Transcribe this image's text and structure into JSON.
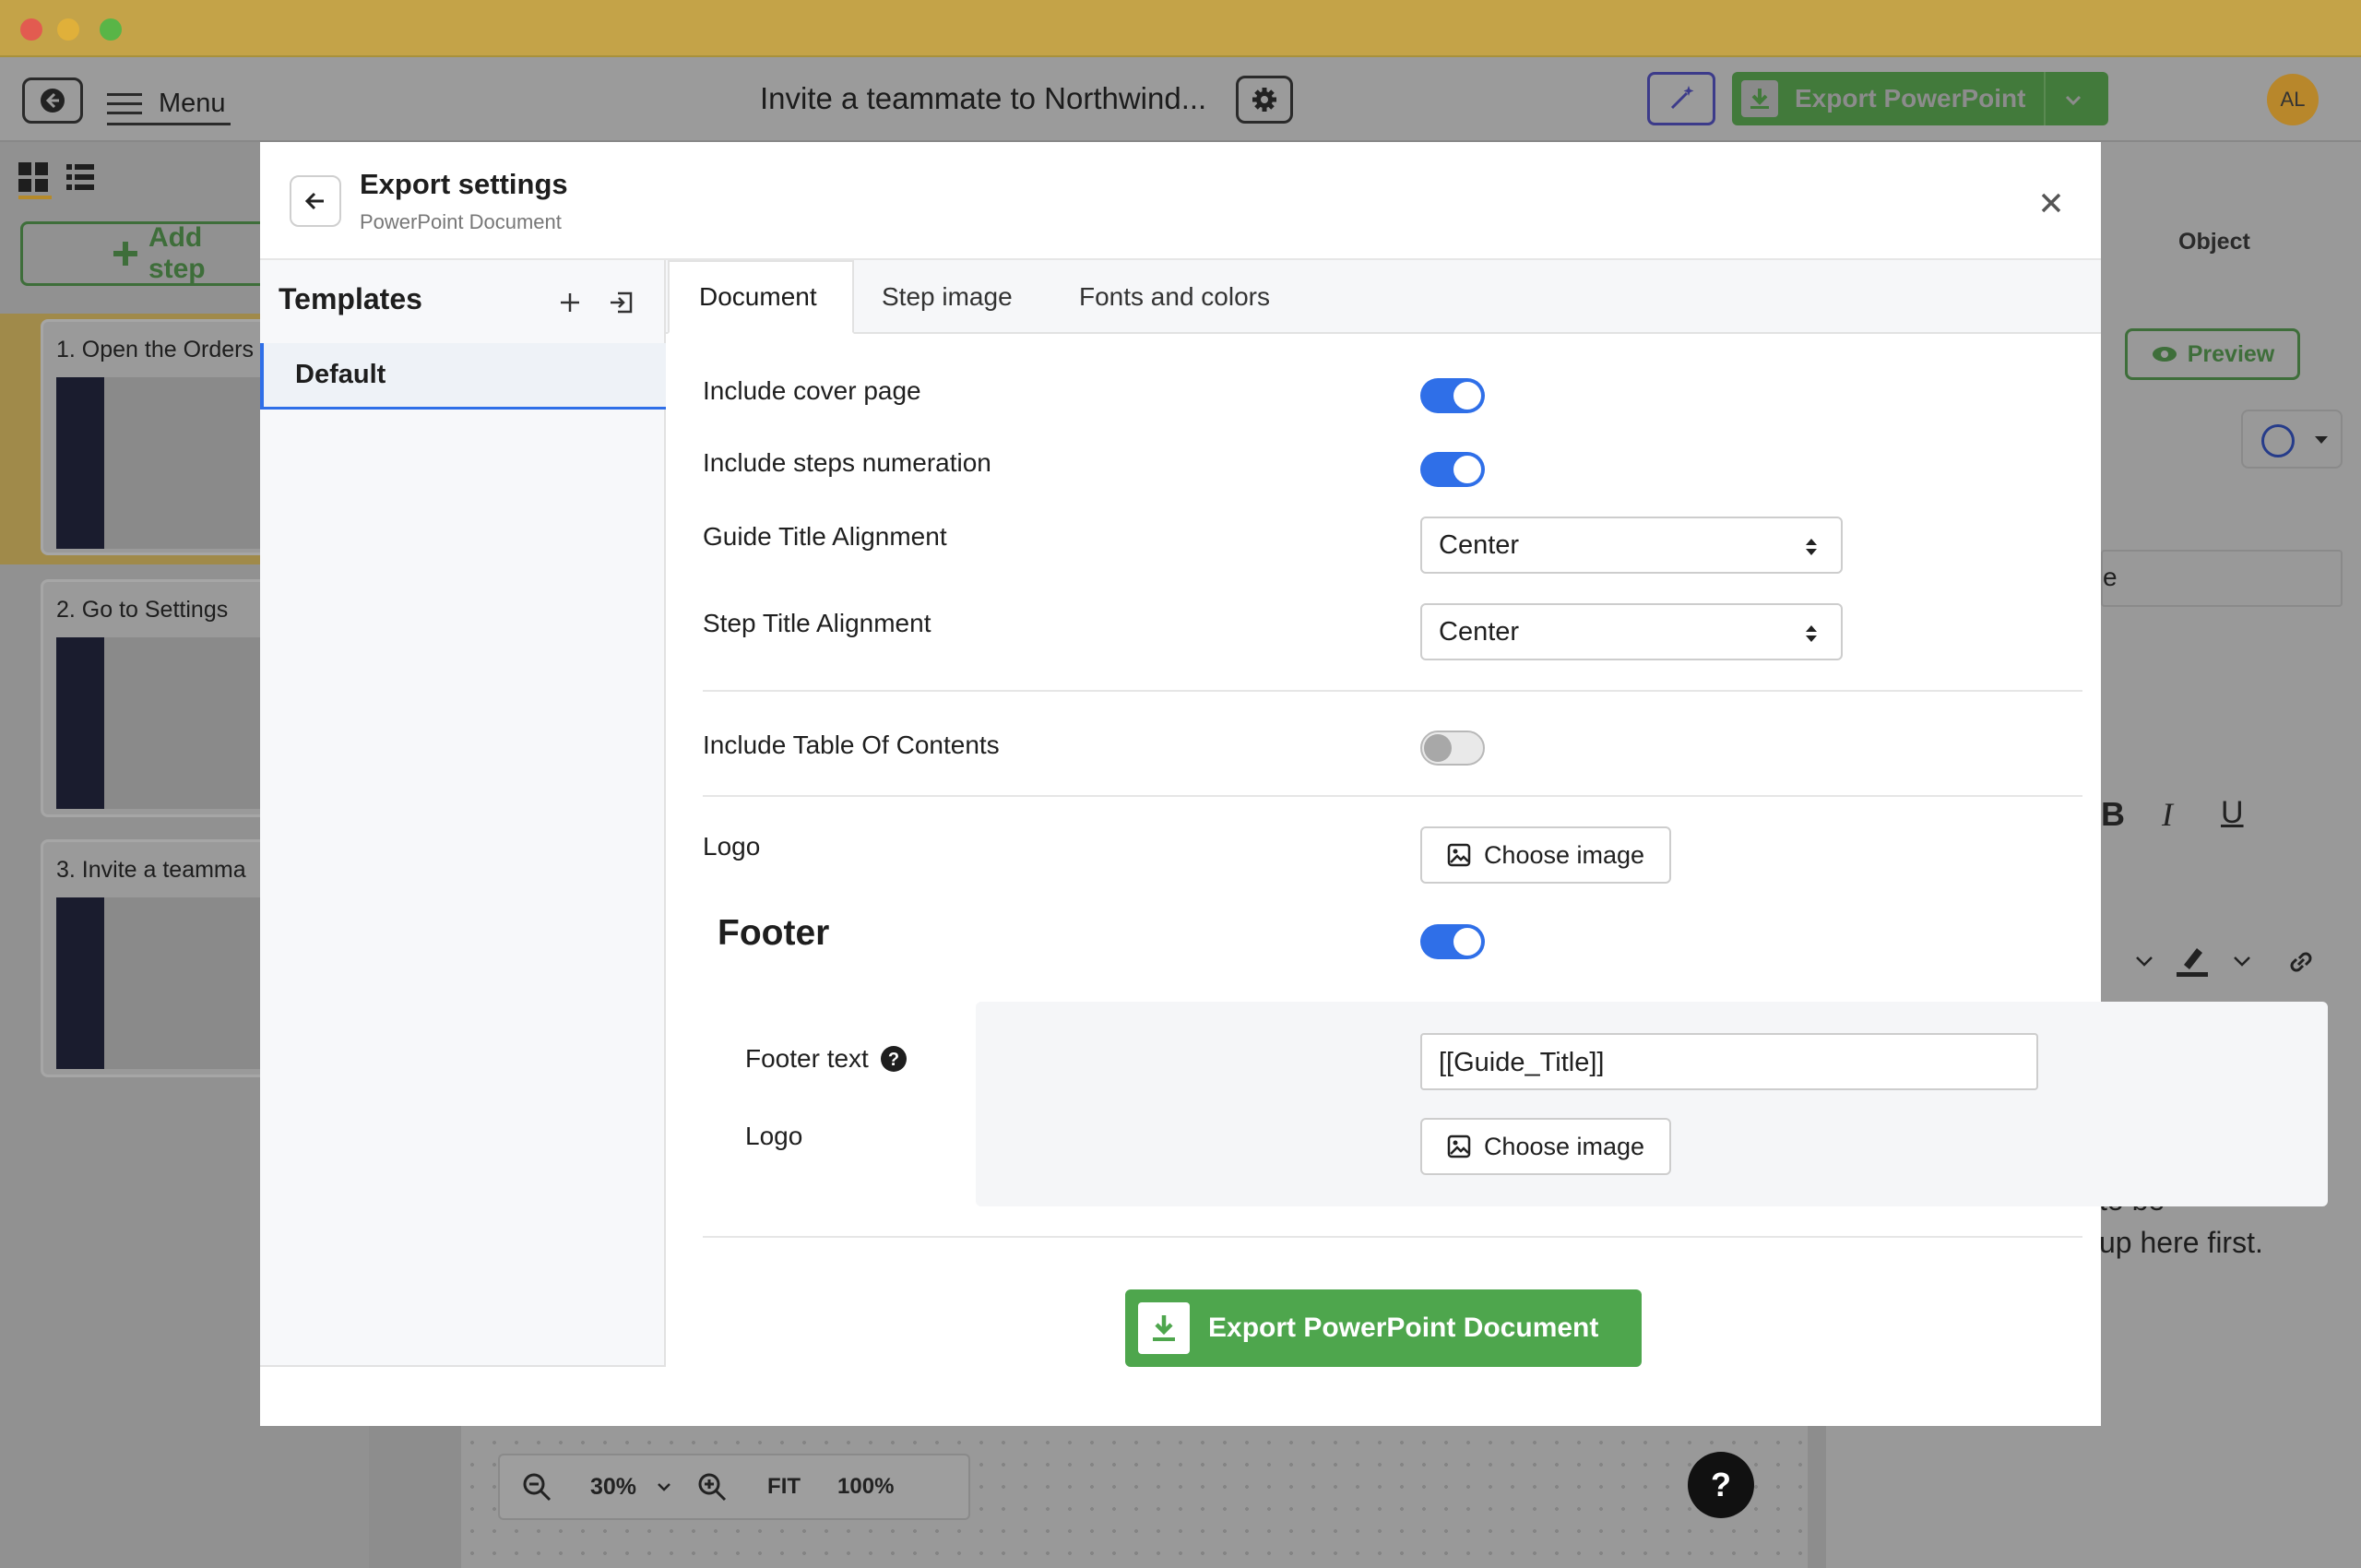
{
  "window": {
    "title": "Invite a teammate to Northwind...",
    "menu_label": "Menu",
    "export_button": "Export PowerPoint",
    "avatar": "AL"
  },
  "left_panel": {
    "add_step": "Add step",
    "steps": [
      "1. Open the Orders",
      "2. Go to Settings",
      "3. Invite a teamma"
    ]
  },
  "right_panel": {
    "object_label": "Object",
    "preview_label": "Preview",
    "fragment_e": "e",
    "hint_line1": "to be",
    "hint_line2": "up here first."
  },
  "zoom": {
    "value": "30%",
    "fit": "FIT",
    "full": "100%"
  },
  "help": "?",
  "modal": {
    "title": "Export settings",
    "subtitle": "PowerPoint Document",
    "templates_title": "Templates",
    "templates": [
      "Default"
    ],
    "tabs": [
      "Document",
      "Step image",
      "Fonts and colors"
    ],
    "settings": {
      "cover_page": {
        "label": "Include cover page",
        "value": true
      },
      "steps_numeration": {
        "label": "Include steps numeration",
        "value": true
      },
      "guide_title_alignment": {
        "label": "Guide Title Alignment",
        "value": "Center"
      },
      "step_title_alignment": {
        "label": "Step Title Alignment",
        "value": "Center"
      },
      "toc": {
        "label": "Include Table Of Contents",
        "value": false
      },
      "logo": {
        "label": "Logo",
        "button": "Choose image"
      },
      "footer": {
        "label": "Footer",
        "value": true,
        "text_label": "Footer text",
        "text_value": "[[Guide_Title]]",
        "logo_label": "Logo",
        "logo_button": "Choose image"
      }
    },
    "export_button": "Export PowerPoint Document"
  },
  "colors": {
    "toggle_on": "#2f6fe8",
    "export_green": "#4ea64d",
    "titlebar": "#c4a348"
  },
  "icons": [
    "back-circle-icon",
    "hamburger-icon",
    "gear-icon",
    "magic-wand-icon",
    "download-icon",
    "chevron-down-icon",
    "grid-view-icon",
    "list-view-icon",
    "plus-icon",
    "arrow-left-icon",
    "close-icon",
    "import-icon",
    "sort-arrows-icon",
    "image-icon",
    "help-circle-icon",
    "zoom-out-icon",
    "zoom-in-icon",
    "eye-icon"
  ]
}
